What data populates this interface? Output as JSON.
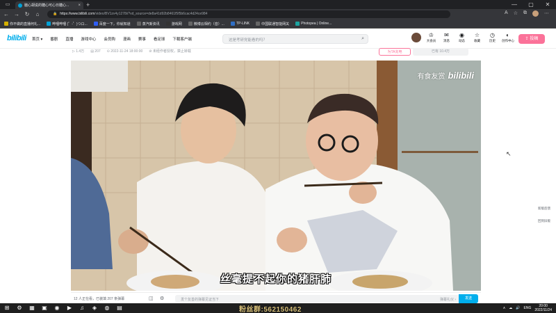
{
  "browser": {
    "tab_title": "脑心胡说的糖心可心日糖心...",
    "tab_close": "×",
    "new_tab": "+",
    "url_host": "https://www.bilibili.com",
    "url_path": "/video/BV1zv4y1278i/?vd_source=de8a41d92b8461f5f5b6cac4d24ce984",
    "lock": "🔒",
    "window_controls": [
      "—",
      "▢",
      "✕"
    ],
    "nav": [
      "←",
      "→",
      "↻",
      "⌂"
    ],
    "addr_icons": [
      "A",
      "☆",
      "⧉",
      "⋯"
    ]
  },
  "bookmarks": [
    {
      "label": "你不做的直播何礼...",
      "color": "#d4b000"
    },
    {
      "label": "哔哩哔哩 (゜-゜)つロ...",
      "color": "#00a1d6"
    },
    {
      "label": "百度一下，你就知道",
      "color": "#2f5ff5"
    },
    {
      "label": "蒸汽新资讯",
      "color": "#666"
    },
    {
      "label": "游戏网",
      "color": "#333"
    },
    {
      "label": "微博云相约（音）...",
      "color": "#666"
    },
    {
      "label": "TP-LINK",
      "color": "#2f6fc5"
    },
    {
      "label": "中国联通智能网关",
      "color": "#666"
    },
    {
      "label": "Photopea | Online...",
      "color": "#1ca4a0"
    }
  ],
  "header": {
    "logo": "bilibili",
    "nav": [
      "首页 ▾",
      "番剧",
      "直播",
      "游戏中心",
      "会员购",
      "漫画",
      "赛事",
      "看足球",
      "下载客户端"
    ],
    "search_placeholder": "这是考研党能看的吗？",
    "search_icon": "⌕",
    "icons": [
      {
        "glyph": "♔",
        "label": "大会员"
      },
      {
        "glyph": "✉",
        "label": "消息"
      },
      {
        "glyph": "◉",
        "label": "动态"
      },
      {
        "glyph": "☆",
        "label": "收藏"
      },
      {
        "glyph": "◷",
        "label": "历史"
      },
      {
        "glyph": "◐",
        "label": "创作中心"
      }
    ],
    "upload": "⇪ 投稿"
  },
  "video_meta": {
    "views": "▷ 1.4万",
    "danmaku_count": "▤ 207",
    "date": "⊙ 2022-11-24 18:00:00",
    "no_reprint": "⊘ 未经作者授权，禁止转载",
    "charge_button": "为TA充电",
    "count_button": "已有 10.4万"
  },
  "video": {
    "watermark_text": "有食友赏",
    "watermark_logo": "bilibili",
    "subtitle": "丝毫提不起你的猪肝肺"
  },
  "side_float": [
    "新版反馈",
    "回到旧版"
  ],
  "danmaku_bar": {
    "info": "12 人正在看，已装填 207 条弹幕",
    "icons": [
      "◫",
      "⚙"
    ],
    "placeholder": "发个友善的弹幕见证当下",
    "etiquette": "弹幕礼仪 ›",
    "send": "发送"
  },
  "taskbar": {
    "apps": [
      "⊞",
      "⚙",
      "▦",
      "▣",
      "◉",
      "▶",
      "♫",
      "◈",
      "◍",
      "▤"
    ],
    "fan_group": "粉丝群:562150462",
    "tray": [
      "∧",
      "☁",
      "🔊",
      "ENG"
    ],
    "time": "20:00",
    "date": "2022/11/24"
  }
}
